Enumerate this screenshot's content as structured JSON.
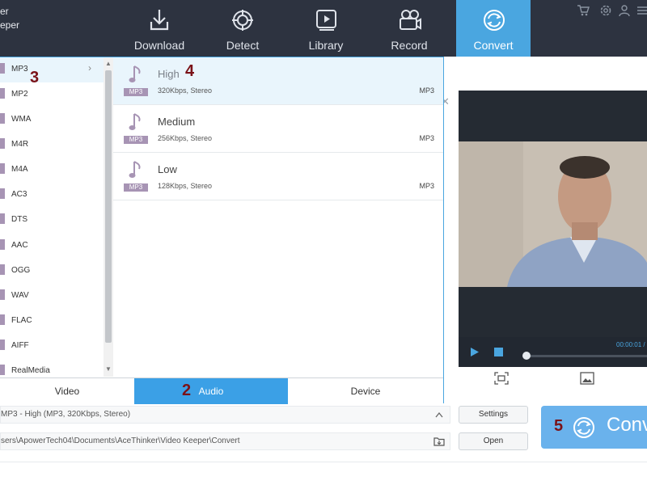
{
  "app": {
    "name_line1": "er",
    "name_line2": "eper"
  },
  "nav": [
    {
      "label": "Download",
      "icon": "download-icon"
    },
    {
      "label": "Detect",
      "icon": "detect-icon"
    },
    {
      "label": "Library",
      "icon": "library-icon"
    },
    {
      "label": "Record",
      "icon": "record-icon"
    },
    {
      "label": "Convert",
      "icon": "convert-icon",
      "active": true
    }
  ],
  "top_icons": [
    "cart-icon",
    "settings-icon",
    "user-icon",
    "menu-icon"
  ],
  "formats": [
    "MP3",
    "MP2",
    "WMA",
    "M4R",
    "M4A",
    "AC3",
    "DTS",
    "AAC",
    "OGG",
    "WAV",
    "FLAC",
    "AIFF",
    "RealMedia"
  ],
  "selected_format": "MP3",
  "presets": [
    {
      "name": "High",
      "desc": "320Kbps, Stereo",
      "format": "MP3",
      "badge": "MP3",
      "selected": true
    },
    {
      "name": "Medium",
      "desc": "256Kbps, Stereo",
      "format": "MP3",
      "badge": "MP3"
    },
    {
      "name": "Low",
      "desc": "128Kbps, Stereo",
      "format": "MP3",
      "badge": "MP3"
    }
  ],
  "tabs": [
    {
      "label": "Video"
    },
    {
      "label": "Audio",
      "active": true
    },
    {
      "label": "Device"
    }
  ],
  "markers": {
    "m2": "2",
    "m3": "3",
    "m4": "4",
    "m5": "5"
  },
  "output": {
    "profile_value": "MP3 - High (MP3, 320Kbps, Stereo)",
    "path_value": "sers\\ApowerTech04\\Documents\\AceThinker\\Video Keeper\\Convert"
  },
  "buttons": {
    "settings": "Settings",
    "open": "Open",
    "convert": "Conv"
  },
  "player": {
    "time": "00:00:01 /"
  },
  "colors": {
    "topbar": "#2d3340",
    "accent": "#4aa6e0",
    "convert_button": "#6ab2ec",
    "marker": "#7a1218",
    "badge": "#a794b4"
  }
}
